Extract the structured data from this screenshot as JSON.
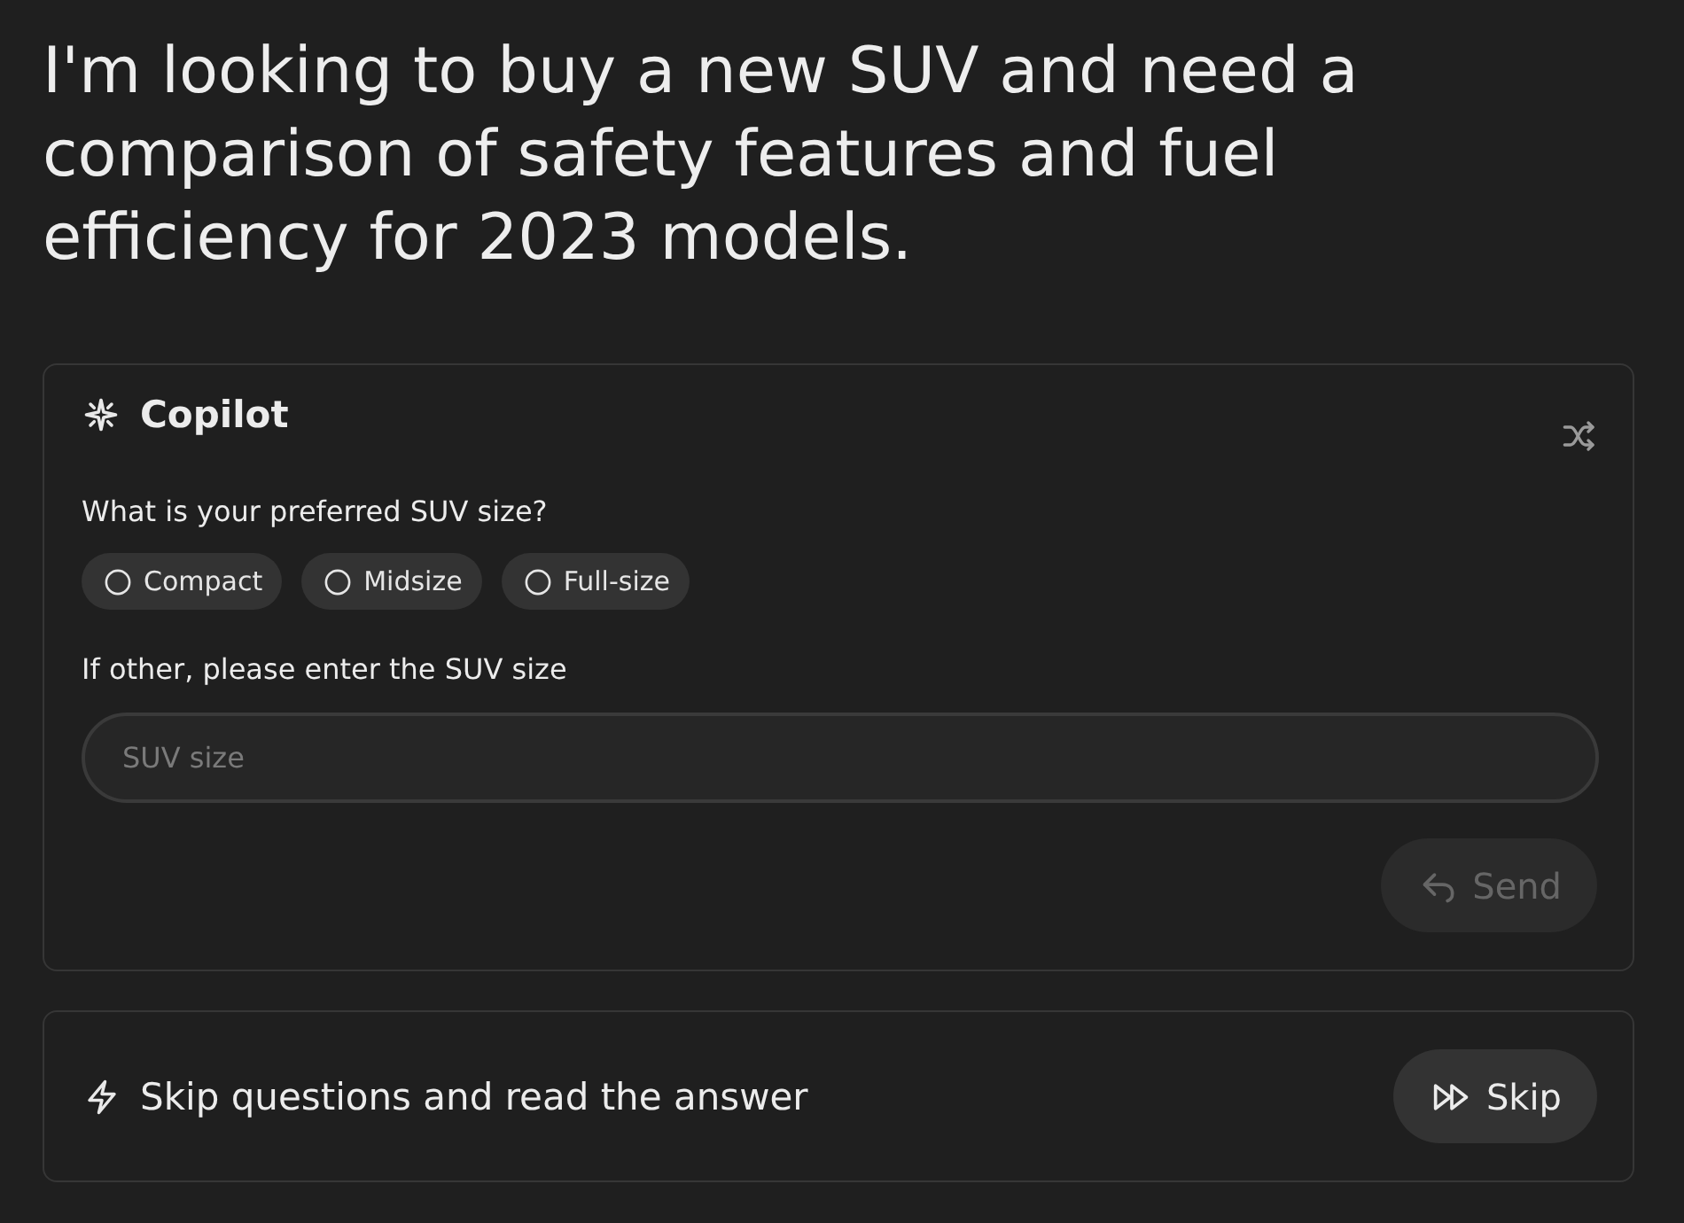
{
  "prompt": {
    "text": "I'm looking to buy a new SUV and need a comparison of safety features and fuel efficiency for 2023 models."
  },
  "copilot": {
    "title": "Copilot",
    "question": "What is your preferred SUV size?",
    "options": [
      {
        "label": "Compact",
        "selected": false
      },
      {
        "label": "Midsize",
        "selected": false
      },
      {
        "label": "Full-size",
        "selected": false
      }
    ],
    "other_label": "If other, please enter the SUV size",
    "input": {
      "placeholder": "SUV size"
    },
    "send_button": {
      "label": "Send",
      "disabled": true
    }
  },
  "skip_panel": {
    "text": "Skip questions and read the answer",
    "button": {
      "label": "Skip"
    }
  }
}
